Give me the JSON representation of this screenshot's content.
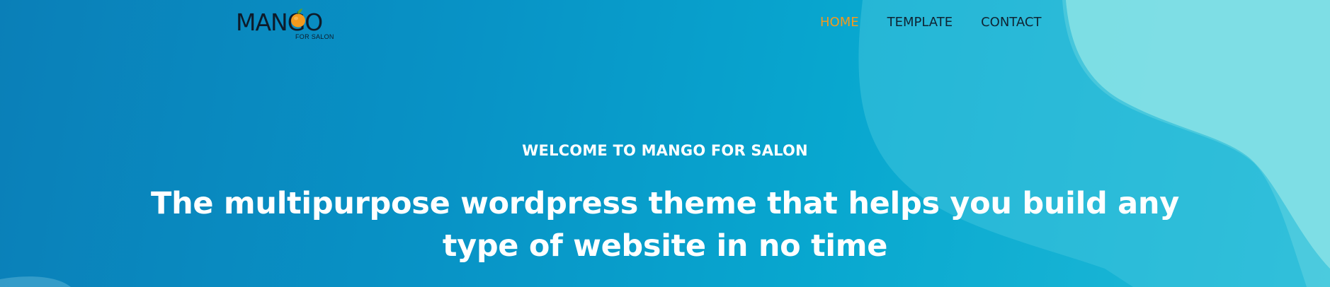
{
  "brand": {
    "logo_word": "MANGO",
    "logo_sub": "FOR SALON",
    "icon": "mango-icon"
  },
  "nav": {
    "items": [
      {
        "label": "HOME",
        "active": true
      },
      {
        "label": "TEMPLATE",
        "active": false
      },
      {
        "label": "CONTACT",
        "active": false
      }
    ]
  },
  "hero": {
    "kicker": "WELCOME TO MANGO FOR SALON",
    "headline": "The multipurpose wordpress theme that helps you build any type of website in no time"
  },
  "colors": {
    "nav_active": "#f39a1d",
    "nav_text": "#0f2433",
    "hero_text": "#ffffff",
    "bg_start": "#0a7fb8",
    "bg_end": "#21bcd8",
    "wave_light": "#8fe6e6"
  }
}
